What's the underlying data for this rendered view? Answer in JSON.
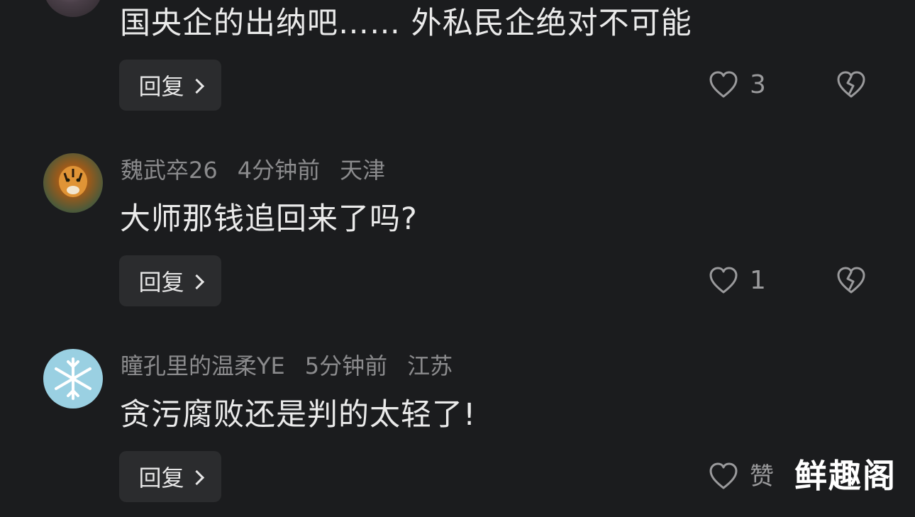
{
  "comments": [
    {
      "text": "国央企的出纳吧…… 外私民企绝对不可能",
      "reply_label": "回复",
      "likes": "3"
    },
    {
      "author": "魏武卒26",
      "time": "4分钟前",
      "location": "天津",
      "text": "大师那钱追回来了吗?",
      "reply_label": "回复",
      "likes": "1"
    },
    {
      "author": "瞳孔里的温柔YE",
      "time": "5分钟前",
      "location": "江苏",
      "text": "贪污腐败还是判的太轻了!",
      "reply_label": "回复",
      "likes": "赞"
    }
  ],
  "watermark": "鲜趣阁",
  "colors": {
    "background": "#1b1c1e",
    "meta": "#8b8b8d",
    "button_bg": "#2b2c2e",
    "icon": "#9a9a9c"
  }
}
